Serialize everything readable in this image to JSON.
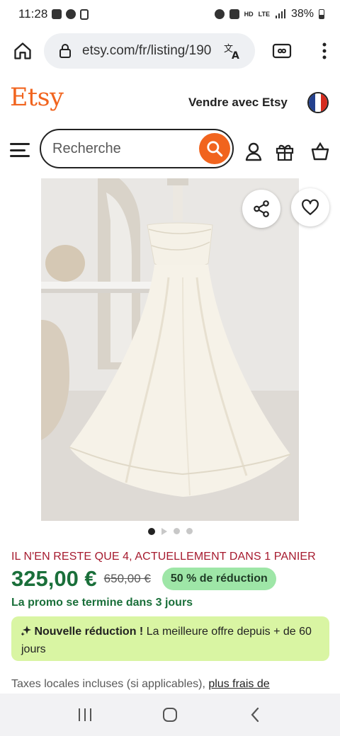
{
  "status_bar": {
    "time": "11:28",
    "battery": "38%"
  },
  "browser": {
    "url": "etsy.com/fr/listing/190"
  },
  "header": {
    "logo": "Etsy",
    "sell_link": "Vendre avec Etsy",
    "search_placeholder": "Recherche",
    "colors": {
      "brand": "#f1641e"
    }
  },
  "gallery": {
    "image_count": 4,
    "active_index": 0
  },
  "listing": {
    "stock_notice": "IL N'EN RESTE QUE 4, ACTUELLEMENT DANS 1 PANIER",
    "price": "325,00 €",
    "original_price": "650,00 €",
    "discount_badge": "50 % de réduction",
    "promo_end": "La promo se termine dans 3 jours",
    "new_discount_title": "Nouvelle réduction !",
    "new_discount_text": " La meilleure offre depuis + de 60 jours",
    "tax_text": "Taxes locales incluses (si applicables), ",
    "shipping_link": "plus frais de",
    "colors": {
      "price": "#1a6f3a",
      "stock": "#a61a2e",
      "badge": "#9ee6a7",
      "notice": "#d9f5a3"
    }
  }
}
